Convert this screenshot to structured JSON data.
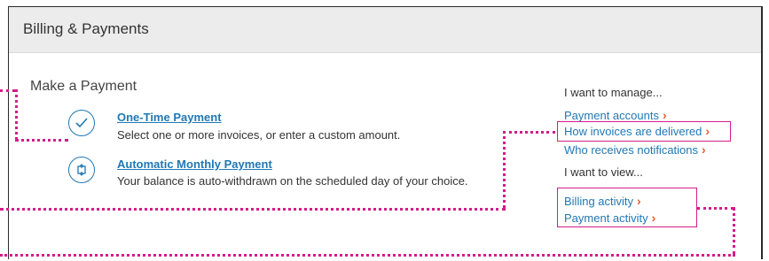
{
  "header": {
    "title": "Billing & Payments"
  },
  "payment": {
    "section_title": "Make a Payment",
    "one_time": {
      "label": "One-Time Payment",
      "description": "Select one or more invoices, or enter a custom amount."
    },
    "automatic": {
      "label": "Automatic Monthly Payment",
      "description": "Your balance is auto-withdrawn on the scheduled day of your choice."
    }
  },
  "manage": {
    "heading": "I want to manage...",
    "links": [
      "Payment accounts",
      "How invoices are delivered",
      "Who receives notifications"
    ]
  },
  "view": {
    "heading": "I want to view...",
    "links": [
      "Billing activity",
      "Payment activity"
    ]
  },
  "chevron": "›",
  "colors": {
    "link": "#1f78b4",
    "chevron": "#f05a28",
    "highlight": "#d41c8a",
    "header_bg": "#ececec"
  }
}
